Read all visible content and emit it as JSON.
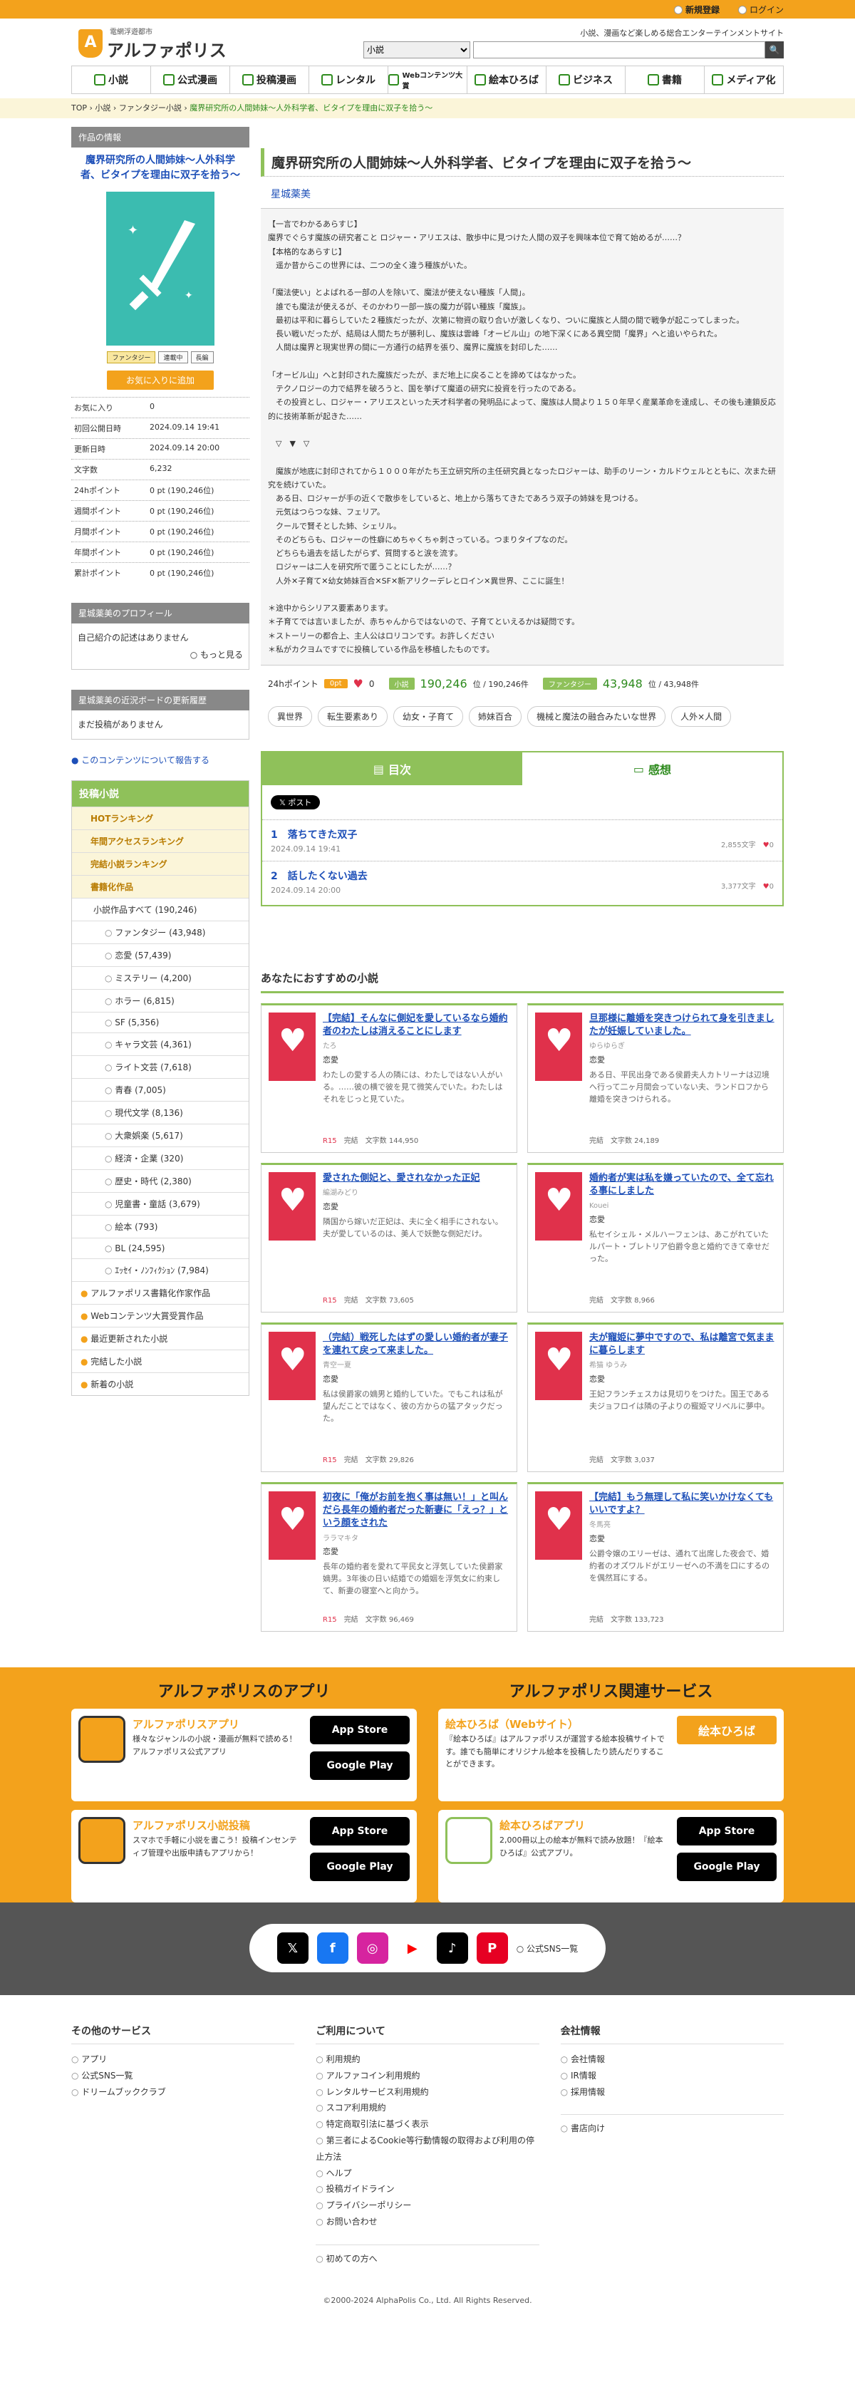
{
  "top": {
    "register": "新規登録",
    "login": "ログイン"
  },
  "header": {
    "logo": "アルファポリス",
    "logo_mark": "A",
    "logo_sub": "電網浮遊都市",
    "tagline": "小説、漫画など楽しめる総合エンターテインメントサイト",
    "search_option": "小説",
    "search_icon": "🔍"
  },
  "gnav": [
    "小説",
    "公式漫画",
    "投稿漫画",
    "レンタル",
    "Webコンテンツ大賞",
    "絵本ひろば",
    "ビジネス",
    "書籍",
    "メディア化"
  ],
  "breadcrumb": [
    "TOP",
    "小説",
    "ファンタジー小説",
    "魔界研究所の人間姉妹〜人外科学者、ビタイプを理由に双子を拾う〜"
  ],
  "work": {
    "section_label": "作品の情報",
    "title": "魔界研究所の人間姉妹〜人外科学者、ビタイプを理由に双子を拾う〜",
    "tags": [
      "ファンタジー",
      "連載中",
      "長編"
    ],
    "fav_button": "お気に入りに追加",
    "stats": [
      {
        "k": "お気に入り",
        "v": "0"
      },
      {
        "k": "初回公開日時",
        "v": "2024.09.14 19:41"
      },
      {
        "k": "更新日時",
        "v": "2024.09.14 20:00"
      },
      {
        "k": "文字数",
        "v": "6,232"
      },
      {
        "k": "24hポイント",
        "v": "0 pt (190,246位)"
      },
      {
        "k": "週間ポイント",
        "v": "0 pt (190,246位)"
      },
      {
        "k": "月間ポイント",
        "v": "0 pt (190,246位)"
      },
      {
        "k": "年間ポイント",
        "v": "0 pt (190,246位)"
      },
      {
        "k": "累計ポイント",
        "v": "0 pt (190,246位)"
      }
    ]
  },
  "profile": {
    "label": "星城薬美のプロフィール",
    "body": "自己紹介の記述はありません",
    "more": "もっと見る"
  },
  "board": {
    "label": "星城薬美の近況ボードの更新履歴",
    "body": "まだ投稿がありません"
  },
  "report": "このコンテンツについて報告する",
  "menu": {
    "head": "投稿小説",
    "items": [
      "HOTランキング",
      "年間アクセスランキング",
      "完結小説ランキング",
      "書籍化作品"
    ],
    "all": "小説作品すべて (190,246)",
    "genres": [
      "ファンタジー (43,948)",
      "恋愛 (57,439)",
      "ミステリー (4,200)",
      "ホラー (6,815)",
      "SF (5,356)",
      "キャラ文芸 (4,361)",
      "ライト文芸 (7,618)",
      "青春 (7,005)",
      "現代文学 (8,136)",
      "大衆娯楽 (5,617)",
      "経済・企業 (320)",
      "歴史・時代 (2,380)",
      "児童書・童話 (3,679)",
      "絵本 (793)",
      "BL (24,595)",
      "ｴｯｾｲ・ﾉﾝﾌｨｸｼｮﾝ (7,984)"
    ],
    "extra": [
      "アルファポリス書籍化作家作品",
      "Webコンテンツ大賞受賞作品",
      "最近更新された小説",
      "完結した小説",
      "新着の小説"
    ]
  },
  "main": {
    "title": "魔界研究所の人間姉妹〜人外科学者、ビタイプを理由に双子を拾う〜",
    "author": "星城薬美",
    "synopsis": "【一言でわかるあらすじ】\n魔界でぐらす魔族の研究者こと ロジャー・アリエスは、散歩中に見つけた人間の双子を興味本位で育て始めるが……？\n【本格的なあらすじ】\n　遥か昔からこの世界には、二つの全く違う種族がいた。\n\n「魔法使い」とよばれる一部の人を除いて、魔法が使えない種族「人間」。\n　誰でも魔法が使えるが、そのかわり一部一族の魔力が弱い種族「魔族」。\n　最初は平和に暮らしていた２種族だったが、次第に物資の取り合いが激しくなり、ついに魔族と人間の間で戦争が起こってしまった。\n　長い戦いだったが、結局は人間たちが勝利し、魔族は雲峰「オービル山」の地下深くにある異空間「魔界」へと追いやられた。\n　人間は魔界と現実世界の間に一方通行の結界を張り、魔界に魔族を封印した……\n\n「オービル山」へと封印された魔族だったが、まだ地上に戻ることを諦めてはなかった。\n　テクノロジーの力で結界を破ろうと、国を挙げて魔道の研究に投資を行ったのである。\n　その投資とし、ロジャー・アリエスといった天才科学者の発明品によって、魔族は人間より１５０年早く産業革命を達成し、その後も連鎖反応的に技術革新が起きた……\n\n　▽　▼　▽\n\n　魔族が地底に封印されてから１０００年がたち王立研究所の主任研究員となったロジャーは、助手のリーン・カルドウェルとともに、次また研究を続けていた。\n　ある日、ロジャーが手の近くで散歩をしていると、地上から落ちてきたであろう双子の姉妹を見つける。\n　元気はつらつな妹、フェリア。\n　クールで賢そとした姉、シェリル。\n　そのどちらも、ロジャーの性癖にめちゃくちゃ刺さっている。つまりタイプなのだ。\n　どちらも過去を話したがらず、質問すると涙を流す。\n　ロジャーは二人を研究所で匿うことにしたが……？\n　人外✕子育て✕幼女姉妹百合✕SF✕新アリクーデレとロイン✕異世界、ここに誕生！\n\n＊途中からシリアス要素あります。\n＊子育てでは言いましたが、赤ちゃんからではないので、子育てといえるかは疑問です。\n＊ストーリーの都合上、主人公はロリコンです。お許しください\n＊私がカクヨムですでに投稿している作品を移植したものです。",
    "pt_label": "24hポイント",
    "pt_value": "0pt",
    "likes": "0",
    "rank_label": "小説",
    "rank_value": "190,246",
    "rank_of": "位 / 190,246件",
    "genre_label": "ファンタジー",
    "genre_value": "43,948",
    "genre_of": "位 / 43,948件",
    "keywords": [
      "異世界",
      "転生要素あり",
      "幼女・子育て",
      "姉妹百合",
      "機械と魔法の融合みたいな世界",
      "人外×人間"
    ]
  },
  "toc": {
    "tab_toc": "目次",
    "tab_review": "感想",
    "post": "ポスト",
    "episodes": [
      {
        "no": "1",
        "title": "落ちてきた双子",
        "date": "2024.09.14 19:41",
        "chars": "2,855文字",
        "likes": "0"
      },
      {
        "no": "2",
        "title": "話したくない過去",
        "date": "2024.09.14 20:00",
        "chars": "3,377文字",
        "likes": "0"
      }
    ]
  },
  "rec": {
    "heading": "あなたにおすすめの小説",
    "items": [
      {
        "title": "【完結】そんなに側妃を愛しているなら婚約者のわたしは消えることにします",
        "author": "たろ",
        "genre": "恋愛",
        "summary": "わたしの愛する人の隣には、わたしではない人がいる。……彼の横で彼を見て微笑んでいた。わたしはそれをじっと見ていた。",
        "flag": "R15",
        "status": "完結",
        "chars": "文字数 144,950"
      },
      {
        "title": "旦那様に離婚を突きつけられて身を引きましたが妊娠していました。",
        "author": "ゆらゆらぎ",
        "genre": "恋愛",
        "summary": "ある日、平民出身である侯爵夫人カトリーナは辺境へ行って二ヶ月間会っていない夫、ランドロフから離婚を突きつけられる。",
        "flag": "",
        "status": "完結",
        "chars": "文字数 24,189"
      },
      {
        "title": "愛された側妃と、愛されなかった正妃",
        "author": "編湖みどり",
        "genre": "恋愛",
        "summary": "隣国から嫁いだ正妃は、夫に全く相手にされない。夫が愛しているのは、美人で妖艶な側妃だけ。",
        "flag": "R15",
        "status": "完結",
        "chars": "文字数 73,605"
      },
      {
        "title": "婚約者が実は私を嫌っていたので、全て忘れる事にしました",
        "author": "Kouei",
        "genre": "恋愛",
        "summary": "私セイシェル・メルハーフェンは、あこがれていたルパート・ブレトリア伯爵令息と婚約できて幸せだった。",
        "flag": "",
        "status": "完結",
        "chars": "文字数 8,966"
      },
      {
        "title": "（完結）戦死したはずの愛しい婚約者が妻子を連れて戻って来ました。",
        "author": "青空一夏",
        "genre": "恋愛",
        "summary": "私は侯爵家の嫡男と婚約していた。でもこれは私が望んだことではなく、彼の方からの猛アタックだった。",
        "flag": "R15",
        "status": "完結",
        "chars": "文字数 29,826"
      },
      {
        "title": "夫が寵姫に夢中ですので、私は離宮で気ままに暮らします",
        "author": "希猫 ゆうみ",
        "genre": "恋愛",
        "summary": "王妃フランチェスカは見切りをつけた。国王である夫ジョフロイは隣の子よりの寵姫マリベルに夢中。",
        "flag": "",
        "status": "完結",
        "chars": "文字数 3,037"
      },
      {
        "title": "初夜に「俺がお前を抱く事は無い！」と叫んだら長年の婚約者だった新妻に「えっ？」という顔をされた",
        "author": "ララマキタ",
        "genre": "恋愛",
        "summary": "長年の婚約者を愛れて平民女と浮気していた侯爵家嫡男。3年後の日い結婚での婚姻を浮気女に約束して、新妻の寝室へと向かう。",
        "flag": "R15",
        "status": "完結",
        "chars": "文字数 96,469"
      },
      {
        "title": "【完結】もう無理して私に笑いかけなくてもいいですよ？",
        "author": "冬馬亮",
        "genre": "恋愛",
        "summary": "公爵令嬢のエリーゼは、通れて出席した夜会で、婚約者のオズワルドがエリーゼへの不満を口にするのを偶然耳にする。",
        "flag": "",
        "status": "完結",
        "chars": "文字数 133,723"
      }
    ]
  },
  "apps": {
    "app_heading": "アルファポリスのアプリ",
    "rel_heading": "アルファポリス関連サービス",
    "app1": {
      "name": "アルファポリスアプリ",
      "desc": "様々なジャンルの小説・漫画が無料で読める！アルファポリス公式アプリ"
    },
    "app2": {
      "name": "アルファポリス小説投稿",
      "desc": "スマホで手軽に小説を書こう！投稿インセンティブ管理や出版申請もアプリから！"
    },
    "rel1": {
      "name": "絵本ひろば（Webサイト）",
      "desc": "『絵本ひろば』はアルファポリスが運営する絵本投稿サイトです。誰でも簡単にオリジナル絵本を投稿したり読んだりすることができます。",
      "btn": "絵本ひろば"
    },
    "rel2": {
      "name": "絵本ひろばアプリ",
      "desc": "2,000冊以上の絵本が無料で読み放題！『絵本ひろば』公式アプリ。"
    },
    "appstore": "App Store",
    "googleplay": "Google Play"
  },
  "sns": {
    "label": "公式SNS一覧"
  },
  "footer": {
    "c1": {
      "h": "その他のサービス",
      "items": [
        "アプリ",
        "公式SNS一覧",
        "ドリームブッククラブ"
      ]
    },
    "c2": {
      "h": "ご利用について",
      "items": [
        "利用規約",
        "アルファコイン利用規約",
        "レンタルサービス利用規約",
        "スコア利用規約",
        "特定商取引法に基づく表示",
        "第三者によるCookie等行動情報の取得および利用の停止方法",
        "ヘルプ",
        "投稿ガイドライン",
        "プライバシーポリシー",
        "お問い合わせ",
        "初めての方へ"
      ]
    },
    "c3": {
      "h": "会社情報",
      "items": [
        "会社情報",
        "IR情報",
        "採用情報",
        "書店向け"
      ]
    },
    "copyright": "©2000-2024 AlphaPolis Co., Ltd. All Rights Reserved."
  },
  "colors": {
    "accent": "#f3a21c",
    "green": "#8fc15a",
    "link": "#1d4fb8",
    "heart": "#e0314b"
  }
}
